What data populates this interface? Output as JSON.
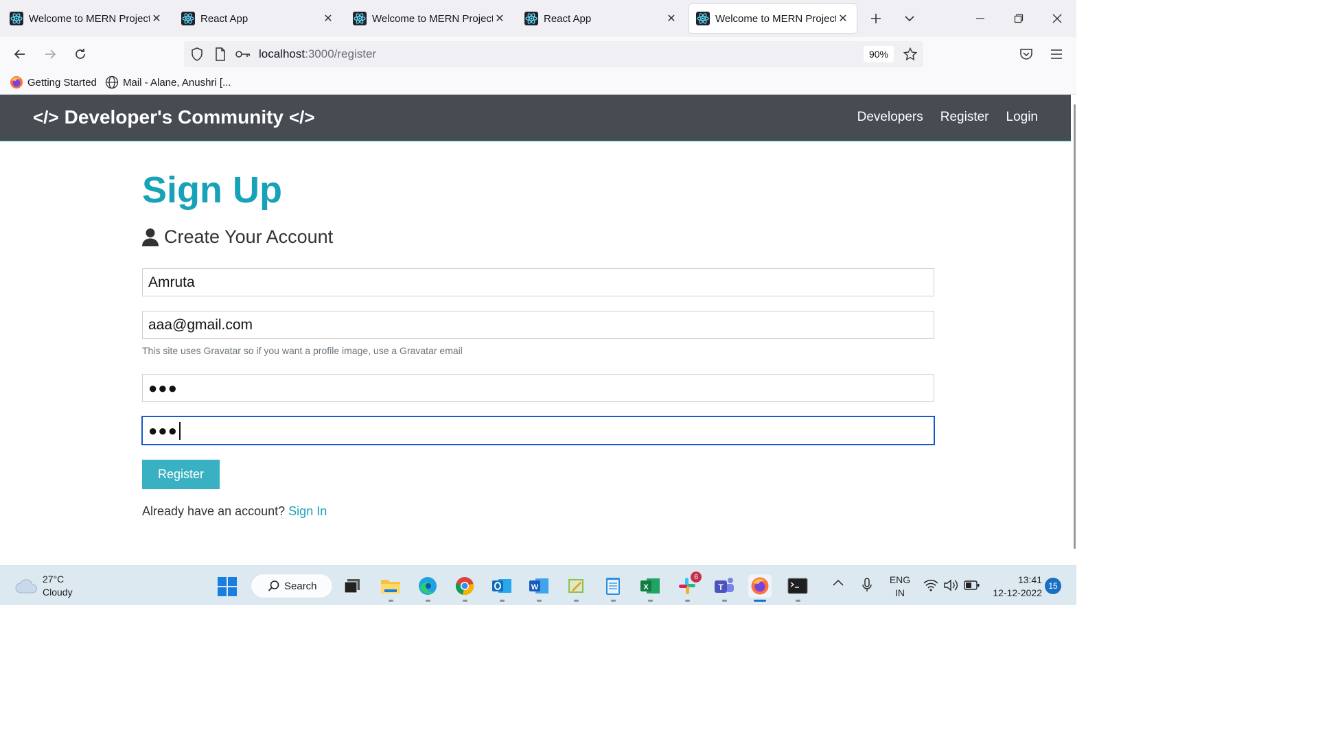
{
  "browser": {
    "tabs": [
      {
        "title": "Welcome to MERN Project",
        "active": false
      },
      {
        "title": "React App",
        "active": false
      },
      {
        "title": "Welcome to MERN Project",
        "active": false
      },
      {
        "title": "React App",
        "active": false
      },
      {
        "title": "Welcome to MERN Project",
        "active": true
      }
    ],
    "url_host": "localhost",
    "url_rest": ":3000/register",
    "zoom": "90%",
    "bookmarks": [
      {
        "label": "Getting Started",
        "icon": "firefox-icon"
      },
      {
        "label": "Mail - Alane, Anushri [...",
        "icon": "globe-icon"
      }
    ]
  },
  "site": {
    "brand": "Developer's Community",
    "brand_icon": "</>",
    "nav_links": [
      "Developers",
      "Register",
      "Login"
    ],
    "accent_color": "#17a2b8",
    "navbar_color": "#474b52"
  },
  "form": {
    "heading": "Sign Up",
    "lead": "Create Your Account",
    "name_value": "Amruta",
    "email_value": "aaa@gmail.com",
    "email_hint": "This site uses Gravatar so if you want a profile image, use a Gravatar email",
    "password_value": "●●●",
    "password2_value": "●●●",
    "submit_label": "Register",
    "signin_prompt": "Already have an account?",
    "signin_link": "Sign In"
  },
  "taskbar": {
    "temperature": "27°C",
    "condition": "Cloudy",
    "search_label": "Search",
    "lang_line1": "ENG",
    "lang_line2": "IN",
    "time": "13:41",
    "date": "12-12-2022",
    "notification_count": "15",
    "slack_badge": "6"
  }
}
